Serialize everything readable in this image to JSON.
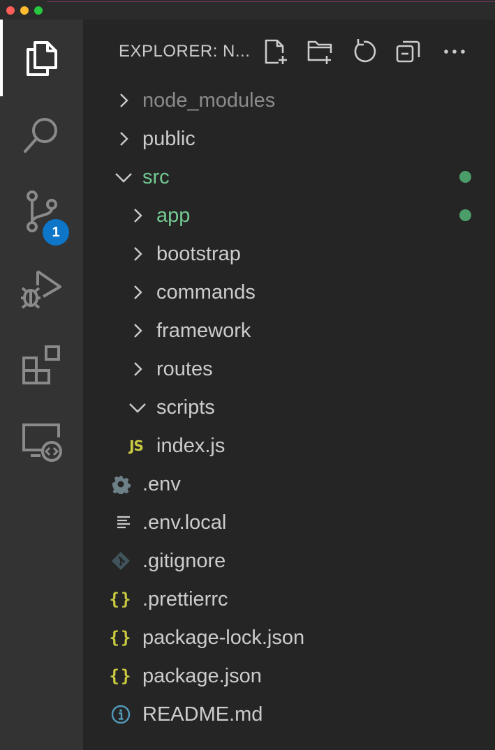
{
  "explorer": {
    "title": "EXPLORER: N...",
    "actions": [
      {
        "name": "new-file",
        "icon": "new-file-icon"
      },
      {
        "name": "new-folder",
        "icon": "new-folder-icon"
      },
      {
        "name": "refresh",
        "icon": "refresh-icon"
      },
      {
        "name": "collapse-all",
        "icon": "collapse-all-icon"
      },
      {
        "name": "more-actions",
        "icon": "ellipsis-icon"
      }
    ]
  },
  "activity_bar": {
    "items": [
      {
        "name": "explorer",
        "icon": "files-icon",
        "active": true
      },
      {
        "name": "search",
        "icon": "search-icon"
      },
      {
        "name": "source-control",
        "icon": "source-control-icon",
        "badge": "1"
      },
      {
        "name": "run-and-debug",
        "icon": "run-debug-icon"
      },
      {
        "name": "extensions",
        "icon": "extensions-icon"
      },
      {
        "name": "remote-explorer",
        "icon": "remote-explorer-icon"
      }
    ]
  },
  "tree": [
    {
      "label": "node_modules",
      "type": "folder",
      "expanded": false,
      "depth": 0,
      "color": "#8b8b8b"
    },
    {
      "label": "public",
      "type": "folder",
      "expanded": false,
      "depth": 0,
      "color": "#cccccc"
    },
    {
      "label": "src",
      "type": "folder",
      "expanded": true,
      "depth": 0,
      "color": "#73c991",
      "status_dot": "#4b9d6a"
    },
    {
      "label": "app",
      "type": "folder",
      "expanded": false,
      "depth": 1,
      "color": "#73c991",
      "status_dot": "#4b9d6a"
    },
    {
      "label": "bootstrap",
      "type": "folder",
      "expanded": false,
      "depth": 1,
      "color": "#cccccc"
    },
    {
      "label": "commands",
      "type": "folder",
      "expanded": false,
      "depth": 1,
      "color": "#cccccc"
    },
    {
      "label": "framework",
      "type": "folder",
      "expanded": false,
      "depth": 1,
      "color": "#cccccc"
    },
    {
      "label": "routes",
      "type": "folder",
      "expanded": false,
      "depth": 1,
      "color": "#cccccc"
    },
    {
      "label": "scripts",
      "type": "folder",
      "expanded": true,
      "depth": 1,
      "color": "#cccccc"
    },
    {
      "label": "index.js",
      "type": "file",
      "icon": "javascript-icon",
      "depth": 1,
      "color": "#cccccc"
    },
    {
      "label": ".env",
      "type": "file",
      "icon": "gear-icon",
      "depth": 0,
      "color": "#cccccc"
    },
    {
      "label": ".env.local",
      "type": "file",
      "icon": "text-lines-icon",
      "depth": 0,
      "color": "#cccccc"
    },
    {
      "label": ".gitignore",
      "type": "file",
      "icon": "git-icon",
      "depth": 0,
      "color": "#cccccc"
    },
    {
      "label": ".prettierrc",
      "type": "file",
      "icon": "json-braces-icon",
      "depth": 0,
      "color": "#cccccc"
    },
    {
      "label": "package-lock.json",
      "type": "file",
      "icon": "json-braces-icon",
      "depth": 0,
      "color": "#cccccc"
    },
    {
      "label": "package.json",
      "type": "file",
      "icon": "json-braces-icon",
      "depth": 0,
      "color": "#cccccc"
    },
    {
      "label": "README.md",
      "type": "file",
      "icon": "info-icon",
      "depth": 0,
      "color": "#cccccc"
    }
  ],
  "colors": {
    "activity_bar": "#333333",
    "sidebar": "#252526",
    "badge": "#0e76c8",
    "modified_green": "#73c991",
    "json_yellow": "#cbcb41",
    "info_blue": "#519aba"
  }
}
